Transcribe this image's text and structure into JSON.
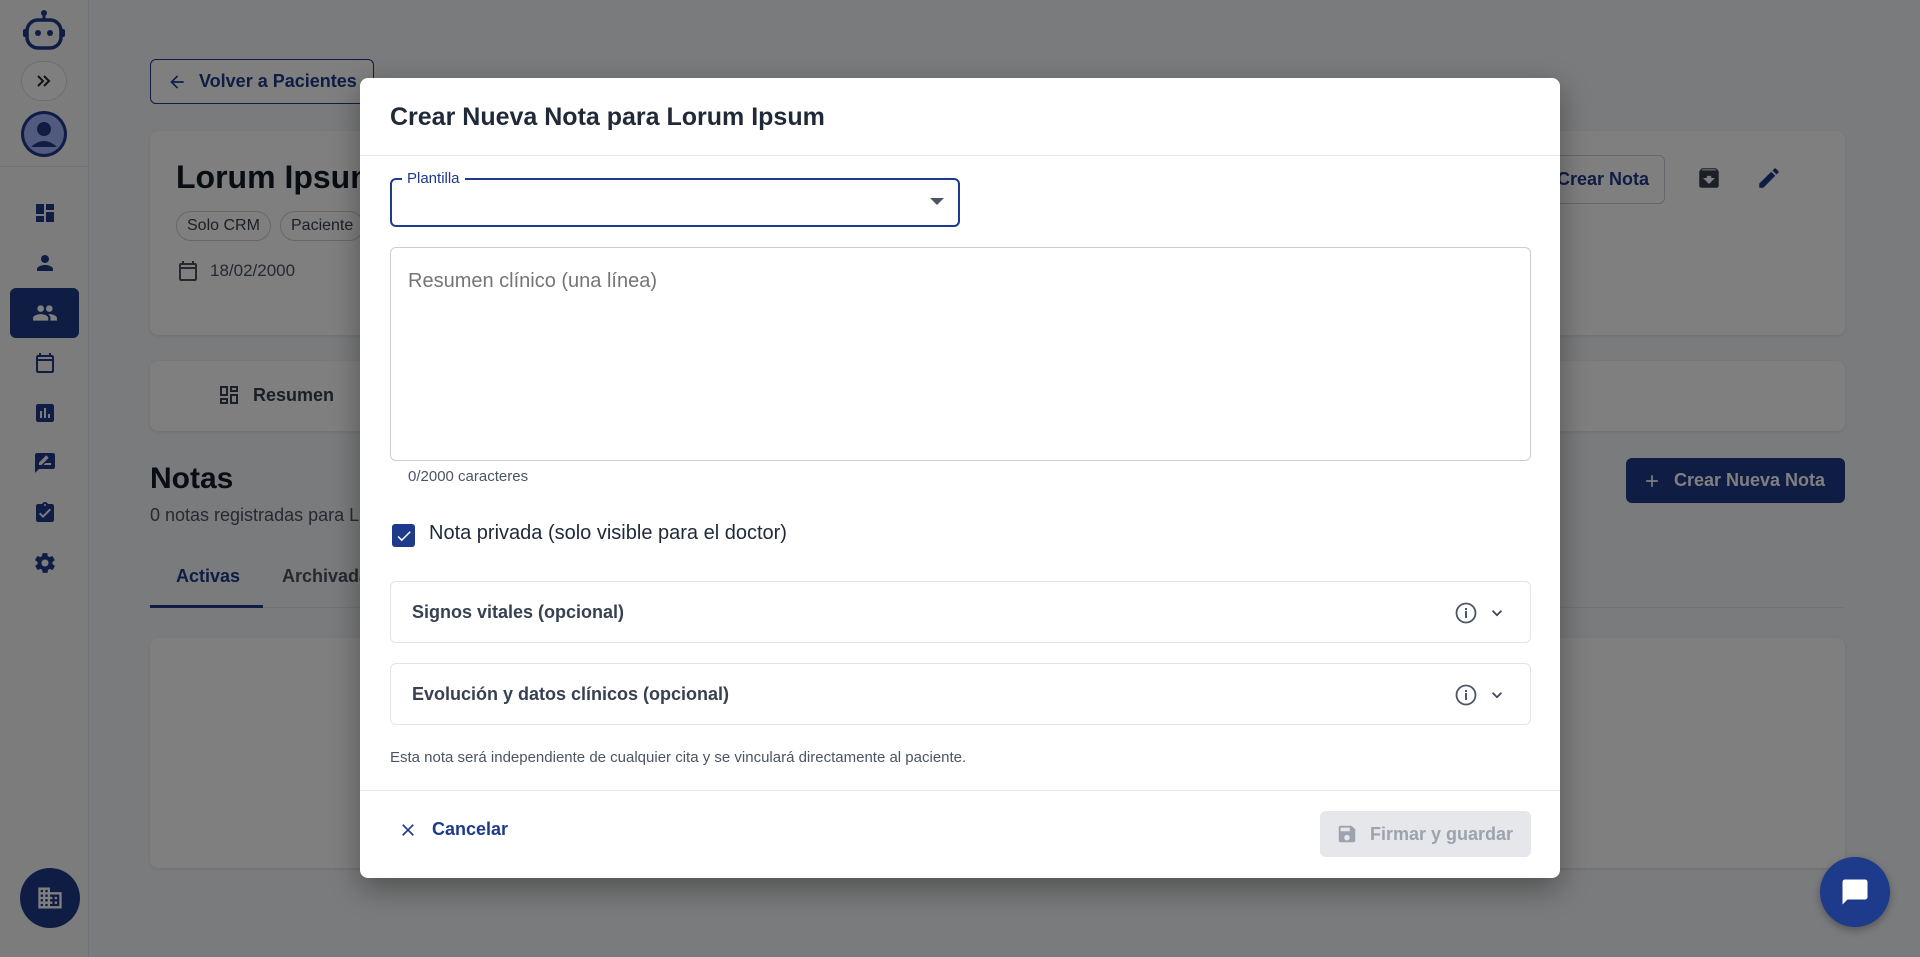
{
  "sidebar": {
    "nav_items": [
      "dashboard",
      "person",
      "patients",
      "calendar",
      "analytics",
      "feedback",
      "tasks",
      "settings"
    ]
  },
  "page": {
    "back_label": "Volver a Pacientes",
    "patient_name": "Lorum Ipsum",
    "chips": [
      "Solo CRM",
      "Paciente"
    ],
    "dob": "18/02/2000",
    "crear_nota_label": "Crear Nota",
    "tab_resumen": "Resumen",
    "notas_title": "Notas",
    "notas_sub": "0 notas registradas para L",
    "crear_nueva_label": "Crear Nueva Nota",
    "subtab_activas": "Activas",
    "subtab_archivadas": "Archivada"
  },
  "modal": {
    "title": "Crear Nueva Nota para Lorum Ipsum",
    "template_label": "Plantilla",
    "template_value": "",
    "summary_placeholder": "Resumen clínico (una línea)",
    "char_count": "0/2000 caracteres",
    "private_label": "Nota privada (solo visible para el doctor)",
    "private_checked": true,
    "accordion_vitals": "Signos vitales (opcional)",
    "accordion_evolution": "Evolución y datos clínicos (opcional)",
    "footnote": "Esta nota será independiente de cualquier cita y se vinculará directamente al paciente.",
    "cancel_label": "Cancelar",
    "sign_label": "Firmar y guardar"
  },
  "colors": {
    "primary": "#1e3a8a",
    "disabled_bg": "#e5e7eb",
    "disabled_text": "#9ca3af"
  }
}
